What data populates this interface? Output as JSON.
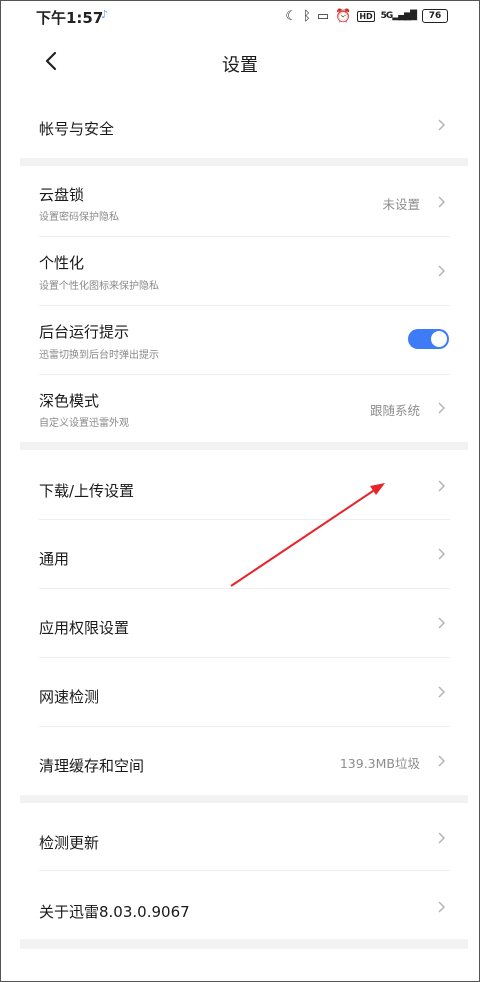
{
  "status_bar": {
    "time": "下午1:57",
    "battery": "76",
    "network": "5G",
    "hd": "HD",
    "icons": [
      "moon-icon",
      "bluetooth-icon",
      "nfc-icon",
      "alarm-icon",
      "hd-icon",
      "signal-icon",
      "battery-icon"
    ]
  },
  "header": {
    "title": "设置",
    "back_icon": "chevron-left-icon"
  },
  "sections": {
    "account": {
      "label": "帐号与安全"
    },
    "cloud_lock": {
      "label": "云盘锁",
      "sub": "设置密码保护隐私",
      "value": "未设置"
    },
    "personalize": {
      "label": "个性化",
      "sub": "设置个性化图标来保护隐私"
    },
    "background_run": {
      "label": "后台运行提示",
      "sub": "迅雷切换到后台时弹出提示",
      "toggle_on": true
    },
    "dark_mode": {
      "label": "深色模式",
      "sub": "自定义设置迅雷外观",
      "value": "跟随系统"
    },
    "download_upload": {
      "label": "下载/上传设置"
    },
    "general": {
      "label": "通用"
    },
    "permissions": {
      "label": "应用权限设置"
    },
    "speed_test": {
      "label": "网速检测"
    },
    "cache": {
      "label": "清理缓存和空间",
      "value": "139.3MB垃圾"
    },
    "check_update": {
      "label": "检测更新"
    },
    "about": {
      "label": "关于迅雷8.03.0.9067"
    }
  },
  "colors": {
    "accent": "#3e7bf7",
    "annotation_arrow": "#e8232a",
    "section_gap": "#f2f2f2"
  }
}
